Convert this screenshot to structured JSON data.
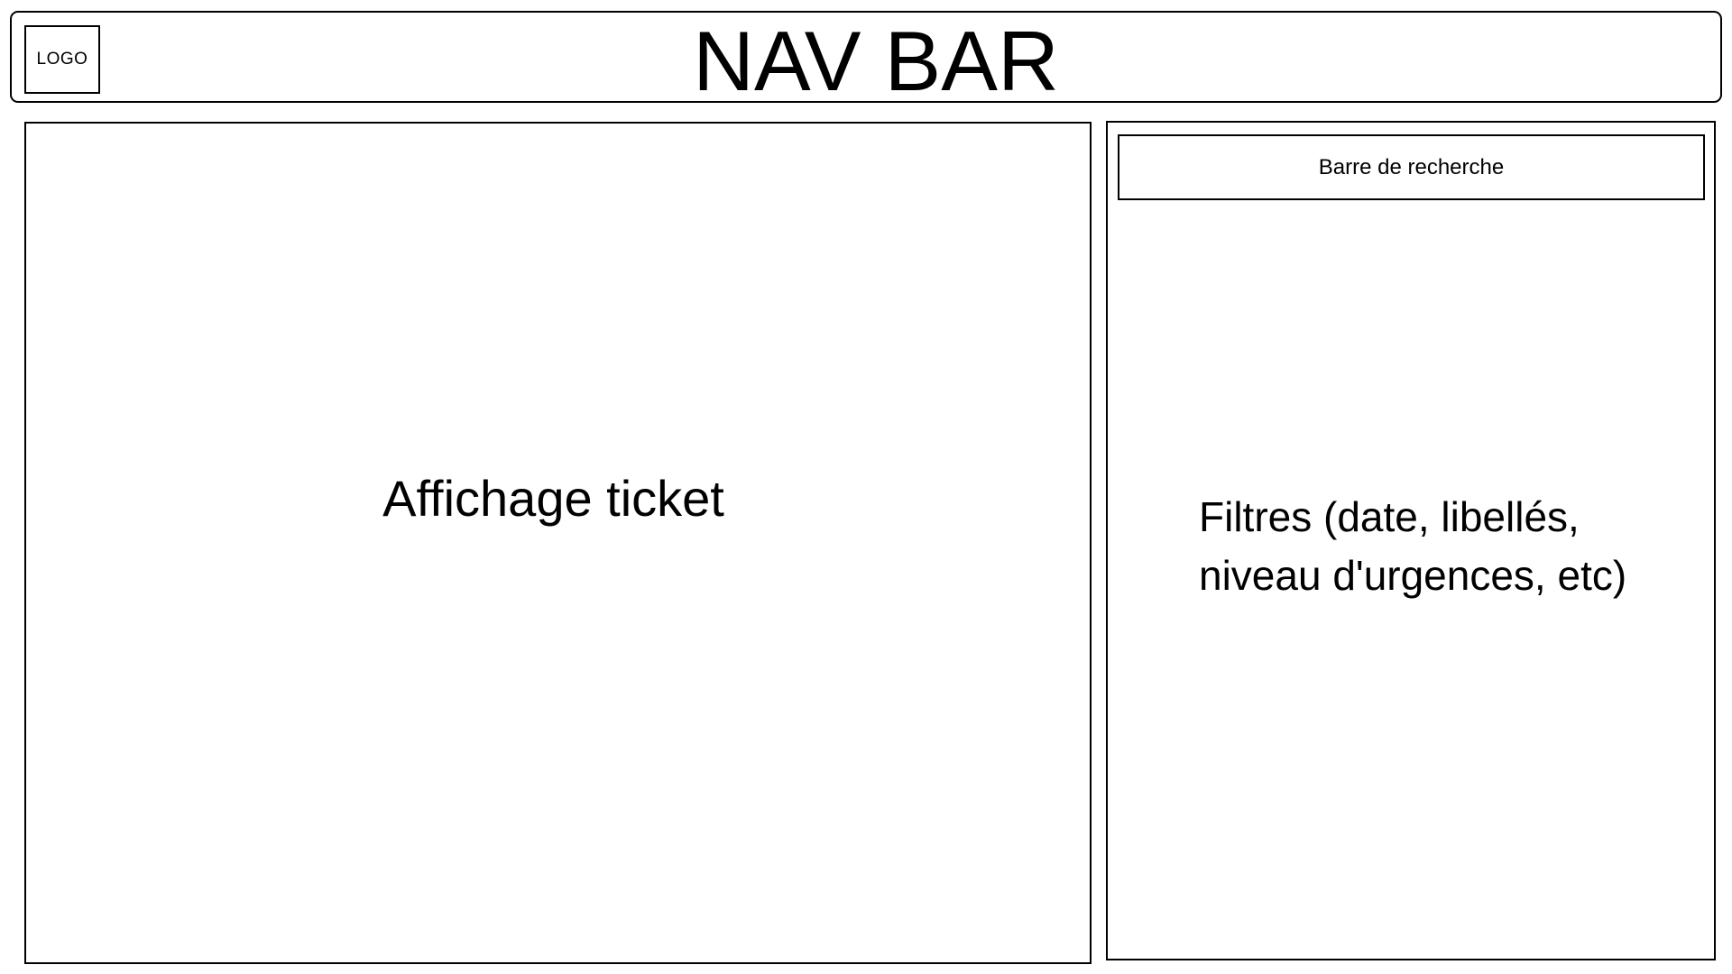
{
  "navbar": {
    "logo_label": "LOGO",
    "title": "NAV BAR"
  },
  "ticket_panel": {
    "label": "Affichage ticket"
  },
  "side_panel": {
    "search_label": "Barre de recherche",
    "filters_line1": "Filtres (date, libellés,",
    "filters_line2": "niveau d'urgences, etc)"
  },
  "colors": {
    "border": "#000000",
    "background": "#ffffff"
  }
}
